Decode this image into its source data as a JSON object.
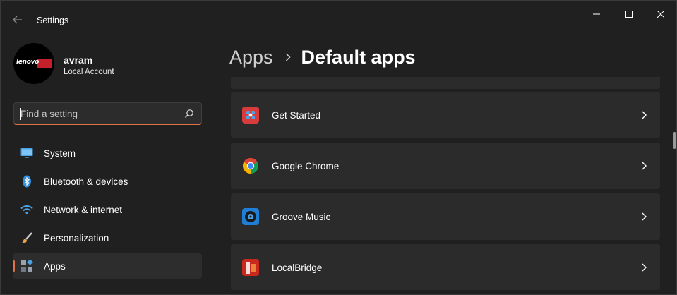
{
  "window": {
    "title": "Settings"
  },
  "profile": {
    "avatar_logo_text": "lenovo",
    "name": "avram",
    "account_type": "Local Account"
  },
  "search": {
    "placeholder": "Find a setting",
    "value": ""
  },
  "nav": {
    "items": [
      {
        "label": "System",
        "icon": "monitor-icon",
        "selected": false
      },
      {
        "label": "Bluetooth & devices",
        "icon": "bluetooth-icon",
        "selected": false
      },
      {
        "label": "Network & internet",
        "icon": "wifi-icon",
        "selected": false
      },
      {
        "label": "Personalization",
        "icon": "brush-icon",
        "selected": false
      },
      {
        "label": "Apps",
        "icon": "apps-icon",
        "selected": true
      }
    ]
  },
  "breadcrumb": {
    "parent": "Apps",
    "current": "Default apps"
  },
  "apps": [
    {
      "name": "Get Started",
      "icon": "get-started-icon"
    },
    {
      "name": "Google Chrome",
      "icon": "chrome-icon"
    },
    {
      "name": "Groove Music",
      "icon": "groove-music-icon"
    },
    {
      "name": "LocalBridge",
      "icon": "localbridge-icon"
    }
  ],
  "colors": {
    "accent": "#e0734a",
    "background": "#202020",
    "card": "#2b2b2b"
  }
}
